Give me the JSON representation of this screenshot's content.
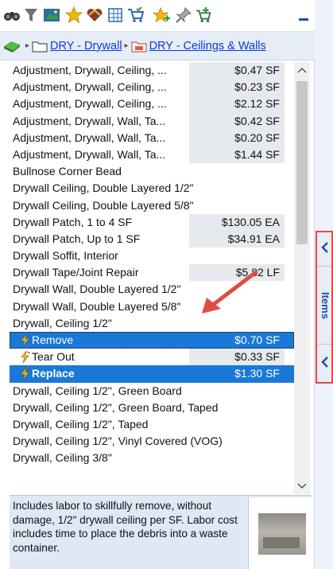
{
  "toolbar": {
    "icons": [
      "binoculars-icon",
      "filter-icon",
      "image-icon",
      "star-icon",
      "heart-icon",
      "calculator-icon",
      "cart-icon",
      "star-add-icon",
      "pin-icon",
      "cart-add-icon"
    ]
  },
  "breadcrumb": {
    "category": "DRY - Drywall",
    "subcategory": "DRY - Ceilings & Walls"
  },
  "items": [
    {
      "name": "Adjustment, Drywall, Ceiling, ...",
      "price": "$0.47 SF"
    },
    {
      "name": "Adjustment, Drywall, Ceiling, ...",
      "price": "$0.23 SF"
    },
    {
      "name": "Adjustment, Drywall, Ceiling, ...",
      "price": "$2.12 SF"
    },
    {
      "name": "Adjustment, Drywall, Wall, Ta...",
      "price": "$0.42 SF"
    },
    {
      "name": "Adjustment, Drywall, Wall, Ta...",
      "price": "$0.20 SF"
    },
    {
      "name": "Adjustment, Drywall, Wall, Ta...",
      "price": "$1.44 SF"
    },
    {
      "name": "Bullnose Corner Bead",
      "price": ""
    },
    {
      "name": "Drywall Ceiling, Double Layered 1/2\"",
      "price": ""
    },
    {
      "name": "Drywall Ceiling, Double Layered 5/8\"",
      "price": ""
    },
    {
      "name": "Drywall Patch, 1 to 4 SF",
      "price": "$130.05 EA"
    },
    {
      "name": "Drywall Patch, Up to 1 SF",
      "price": "$34.91 EA"
    },
    {
      "name": "Drywall Soffit, Interior",
      "price": ""
    },
    {
      "name": "Drywall Tape/Joint Repair",
      "price": "$5.82 LF"
    },
    {
      "name": "Drywall Wall, Double Layered 1/2\"",
      "price": ""
    },
    {
      "name": "Drywall Wall, Double Layered 5/8\"",
      "price": ""
    },
    {
      "name": "Drywall, Ceiling 1/2\"",
      "price": ""
    }
  ],
  "sub_items": [
    {
      "name": "Remove",
      "price": "$0.70 SF"
    },
    {
      "name": "Tear Out",
      "price": "$0.33 SF"
    },
    {
      "name": "Replace",
      "price": "$1.30 SF"
    }
  ],
  "items_after": [
    {
      "name": "Drywall, Ceiling 1/2\", Green Board"
    },
    {
      "name": "Drywall, Ceiling 1/2\", Green Board, Taped"
    },
    {
      "name": "Drywall, Ceiling 1/2\", Taped"
    },
    {
      "name": "Drywall, Ceiling 1/2\", Vinyl Covered (VOG)"
    },
    {
      "name": "Drywall, Ceiling 3/8\""
    }
  ],
  "description": "Includes labor to skillfully remove, without damage, 1/2\" drywall ceiling per SF. Labor cost includes time to place the debris into a waste container.",
  "side_tab": {
    "label": "Items"
  },
  "colors": {
    "selection": "#1a78d8",
    "annotation": "#e24b44",
    "link": "#0a3bd6"
  }
}
